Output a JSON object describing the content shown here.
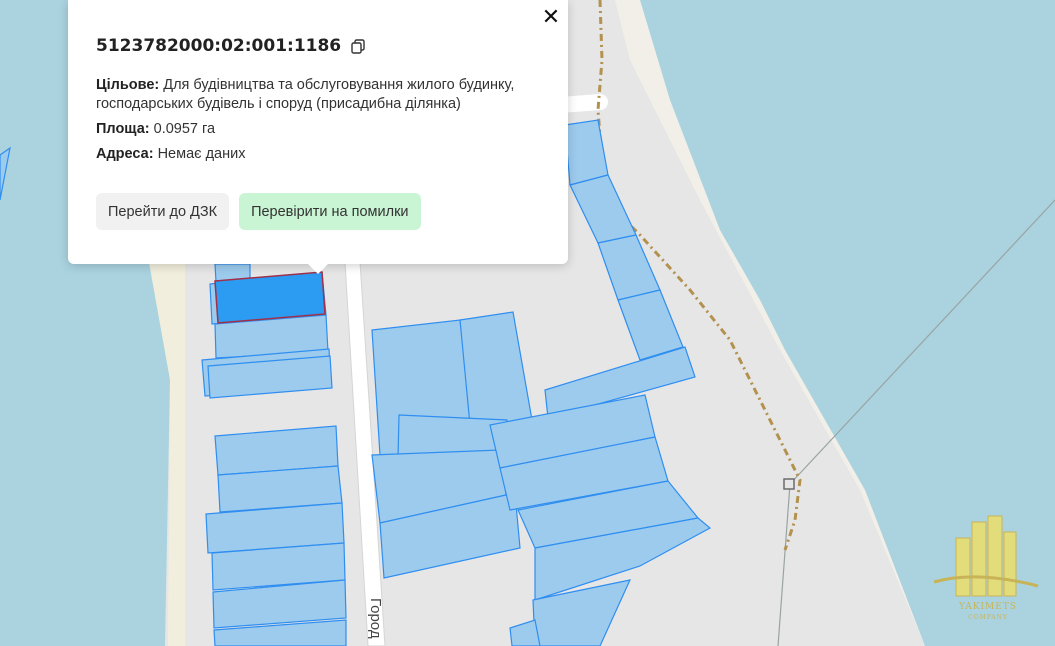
{
  "parcel": {
    "cadastral_number": "5123782000:02:001:1186",
    "purpose_label": "Цільове:",
    "purpose_value": "Для будівництва та обслуговування жилого будинку, господарських будівель і споруд (присадибна ділянка)",
    "area_label": "Площа:",
    "area_value": "0.0957 га",
    "address_label": "Адреса:",
    "address_value": "Немає даних"
  },
  "buttons": {
    "dzk": "Перейти до ДЗК",
    "check": "Перевірити на помилки"
  },
  "map": {
    "street_label": "Город",
    "street_label_tail": "..."
  },
  "watermark": {
    "name": "YAKIMETS",
    "sub": "COMPANY"
  },
  "colors": {
    "water": "#aad3df",
    "land": "#e6e6e6",
    "parcel_fill": "#9ccbed",
    "parcel_stroke": "#2f8ef0",
    "selected_fill": "#2c9bf2",
    "selected_stroke": "#a0304a",
    "check_button_bg": "#c9f5d4"
  }
}
